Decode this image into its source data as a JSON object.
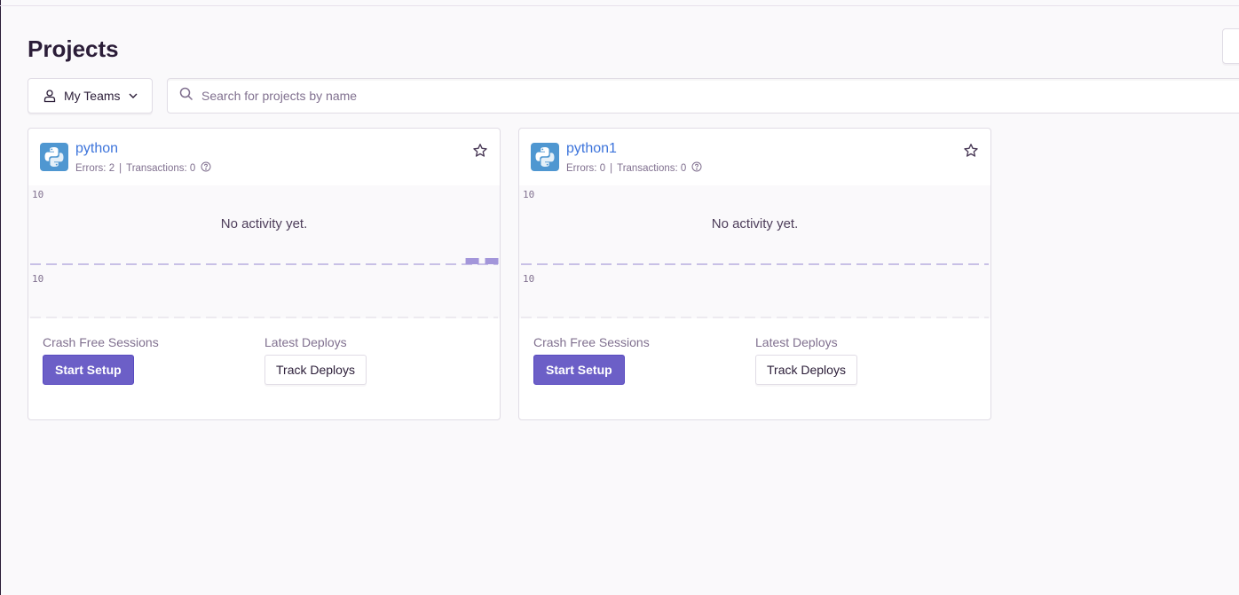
{
  "header": {
    "title": "Projects"
  },
  "filters": {
    "teams_label": "My Teams",
    "search_placeholder": "Search for projects by name"
  },
  "colors": {
    "accent": "#6c5fc7",
    "link": "#3d74db",
    "chart_series": "#a396da",
    "python_icon_bg": "#4f97d1"
  },
  "projects": [
    {
      "name": "python",
      "errors_label": "Errors: 2",
      "transactions_label": "Transactions: 0",
      "icon": "python-icon",
      "chart_top_axis": "10",
      "chart_bottom_axis": "10",
      "no_activity": "No activity yet.",
      "crash_free_label": "Crash Free Sessions",
      "start_setup_label": "Start Setup",
      "latest_deploys_label": "Latest Deploys",
      "track_deploys_label": "Track Deploys",
      "bars": [
        0,
        0,
        0,
        0,
        0,
        0,
        0,
        0,
        0,
        0,
        0,
        0,
        0,
        0,
        0,
        0,
        0,
        0,
        0,
        0,
        0,
        0,
        1,
        1
      ]
    },
    {
      "name": "python1",
      "errors_label": "Errors: 0",
      "transactions_label": "Transactions: 0",
      "icon": "python-icon",
      "chart_top_axis": "10",
      "chart_bottom_axis": "10",
      "no_activity": "No activity yet.",
      "crash_free_label": "Crash Free Sessions",
      "start_setup_label": "Start Setup",
      "latest_deploys_label": "Latest Deploys",
      "track_deploys_label": "Track Deploys",
      "bars": [
        0,
        0,
        0,
        0,
        0,
        0,
        0,
        0,
        0,
        0,
        0,
        0,
        0,
        0,
        0,
        0,
        0,
        0,
        0,
        0,
        0,
        0,
        0,
        0
      ]
    }
  ]
}
